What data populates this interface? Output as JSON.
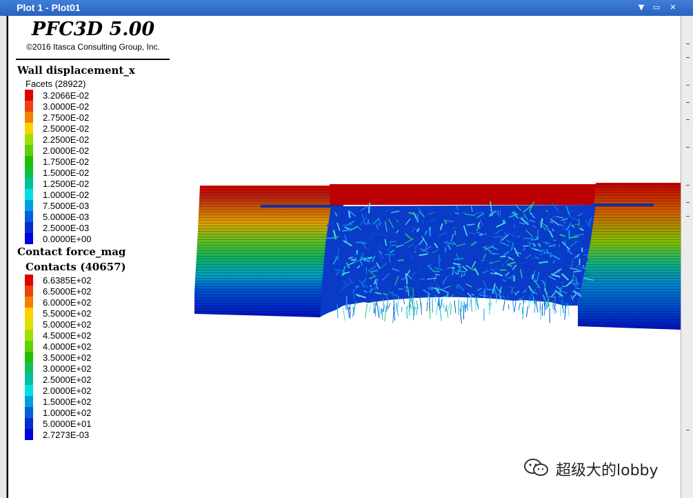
{
  "window": {
    "title": "Plot 1 - Plot01",
    "buttons": [
      "▼",
      "▭",
      "✕"
    ]
  },
  "legend": {
    "program_title": "PFC3D 5.00",
    "copyright": "©2016 Itasca Consulting Group, Inc.",
    "wall_section": {
      "title": "Wall displacement_x",
      "subtitle": "Facets (28922)",
      "scale": [
        {
          "label": "3.2066E-02",
          "color": "#e00000"
        },
        {
          "label": "3.0000E-02",
          "color": "#f04010"
        },
        {
          "label": "2.7500E-02",
          "color": "#f58000"
        },
        {
          "label": "2.5000E-02",
          "color": "#ffd000"
        },
        {
          "label": "2.2500E-02",
          "color": "#a0e000"
        },
        {
          "label": "2.0000E-02",
          "color": "#60d000"
        },
        {
          "label": "1.7500E-02",
          "color": "#20c000"
        },
        {
          "label": "1.5000E-02",
          "color": "#10c040"
        },
        {
          "label": "1.2500E-02",
          "color": "#00c0a0"
        },
        {
          "label": "1.0000E-02",
          "color": "#00e0e0"
        },
        {
          "label": "7.5000E-03",
          "color": "#00a0e0"
        },
        {
          "label": "5.0000E-03",
          "color": "#0060e0"
        },
        {
          "label": "2.5000E-03",
          "color": "#0030d0"
        },
        {
          "label": "0.0000E+00",
          "color": "#0000e0"
        }
      ]
    },
    "contact_section": {
      "title": "Contact force_mag",
      "subtitle": "Contacts (40657)",
      "scale": [
        {
          "label": "6.6385E+02",
          "color": "#e00000"
        },
        {
          "label": "6.5000E+02",
          "color": "#f04010"
        },
        {
          "label": "6.0000E+02",
          "color": "#f58000"
        },
        {
          "label": "5.5000E+02",
          "color": "#ffd000"
        },
        {
          "label": "5.0000E+02",
          "color": "#e0e000"
        },
        {
          "label": "4.5000E+02",
          "color": "#a0e000"
        },
        {
          "label": "4.0000E+02",
          "color": "#60d000"
        },
        {
          "label": "3.5000E+02",
          "color": "#20c000"
        },
        {
          "label": "3.0000E+02",
          "color": "#10c060"
        },
        {
          "label": "2.5000E+02",
          "color": "#00c0a0"
        },
        {
          "label": "2.0000E+02",
          "color": "#00e0e0"
        },
        {
          "label": "1.5000E+02",
          "color": "#00a0e0"
        },
        {
          "label": "1.0000E+02",
          "color": "#0060e0"
        },
        {
          "label": "5.0000E+01",
          "color": "#0030d0"
        },
        {
          "label": "2.7273E-03",
          "color": "#0000e0"
        }
      ]
    }
  },
  "watermark": {
    "text": "超级大的lobby"
  }
}
